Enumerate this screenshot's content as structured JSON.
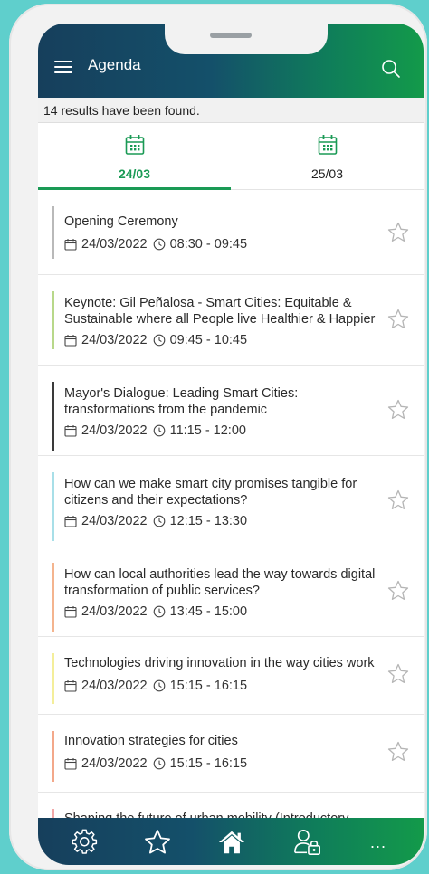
{
  "header": {
    "title": "Agenda",
    "menu_icon": "hamburger-menu-icon",
    "search_icon": "search-icon"
  },
  "results_text": "14 results have been found.",
  "tabs": [
    {
      "label": "24/03",
      "icon": "calendar-icon",
      "active": true
    },
    {
      "label": "25/03",
      "icon": "calendar-icon",
      "active": false
    }
  ],
  "sessions": [
    {
      "title": "Opening Ceremony",
      "date": "24/03/2022",
      "time": "08:30 - 09:45",
      "color": "#b9b9b9"
    },
    {
      "title": "Keynote: Gil Peñalosa - Smart Cities: Equitable & Sustainable where all People live Healthier & Happier",
      "date": "24/03/2022",
      "time": "09:45 - 10:45",
      "color": "#b8d88a"
    },
    {
      "title": "Mayor's Dialogue: Leading Smart Cities: transformations from the pandemic",
      "date": "24/03/2022",
      "time": "11:15 - 12:00",
      "color": "#3a3a3a"
    },
    {
      "title": "How can we make smart city promises tangible for citizens and their expectations?",
      "date": "24/03/2022",
      "time": "12:15 - 13:30",
      "color": "#a8dfe8"
    },
    {
      "title": "How can local authorities lead the way towards digital transformation of public services?",
      "date": "24/03/2022",
      "time": "13:45 - 15:00",
      "color": "#f4b48e"
    },
    {
      "title": "Technologies driving innovation in the way cities work",
      "date": "24/03/2022",
      "time": "15:15 - 16:15",
      "color": "#f4ee9a"
    },
    {
      "title": "Innovation strategies for cities",
      "date": "24/03/2022",
      "time": "15:15 - 16:15",
      "color": "#f3a88a"
    },
    {
      "title": "Shaping the future of urban mobility (Introductory",
      "date": "",
      "time": "",
      "color": "#f3a8a8"
    }
  ],
  "bottom_nav": [
    {
      "name": "settings",
      "icon": "gear-icon"
    },
    {
      "name": "favorites",
      "icon": "star-icon"
    },
    {
      "name": "home",
      "icon": "home-icon"
    },
    {
      "name": "account",
      "icon": "user-lock-icon"
    },
    {
      "name": "more",
      "icon": "more-dots-icon",
      "label": "..."
    }
  ],
  "colors": {
    "accent_green": "#1a9a55",
    "header_start": "#163f5c",
    "header_end": "#139a4a"
  }
}
